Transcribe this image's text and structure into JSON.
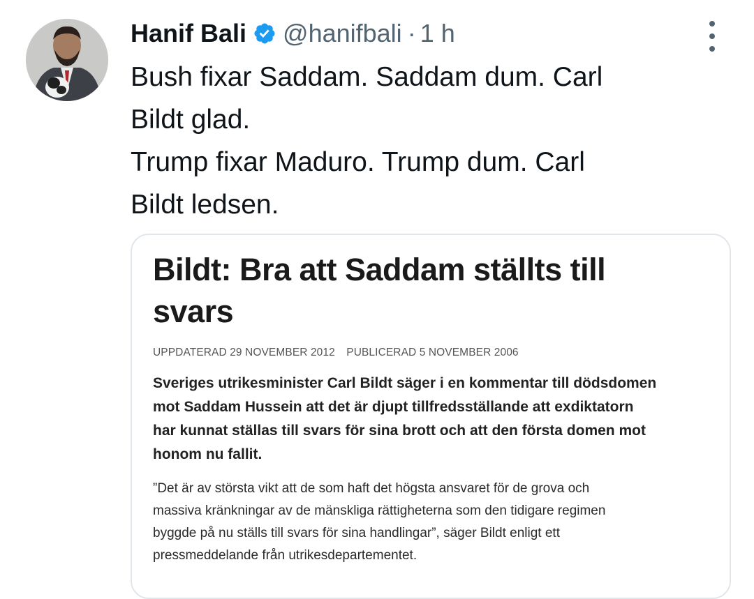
{
  "tweet": {
    "author_name": "Hanif Bali",
    "handle": "@hanifbali",
    "separator": "·",
    "time": "1 h",
    "text_lines": [
      "Bush fixar Saddam. Saddam dum. Carl",
      "Bildt glad.",
      "Trump fixar Maduro. Trump dum. Carl",
      "Bildt ledsen."
    ],
    "verified_color": "#1d9bf0"
  },
  "article": {
    "headline_lines": [
      "Bildt: Bra att Saddam ställts till",
      "svars"
    ],
    "updated": "UPPDATERAD 29 NOVEMBER 2012",
    "published": "PUBLICERAD 5 NOVEMBER 2006",
    "lead_lines": [
      "Sveriges utrikesminister Carl Bildt säger i en kommentar till dödsdomen",
      "mot Saddam Hussein att det är djupt tillfredsställande att exdiktatorn",
      "har kunnat ställas till svars för sina brott och att den första domen mot",
      "honom nu fallit."
    ],
    "quote_lines": [
      "”Det är av största vikt att de som haft det högsta ansvaret för de grova och",
      "massiva kränkningar av de mänskliga rättigheterna som den tidigare regimen",
      "byggde på nu ställs till svars för sina handlingar”, säger Bildt enligt ett",
      "pressmeddelande från utrikesdepartementet."
    ]
  }
}
